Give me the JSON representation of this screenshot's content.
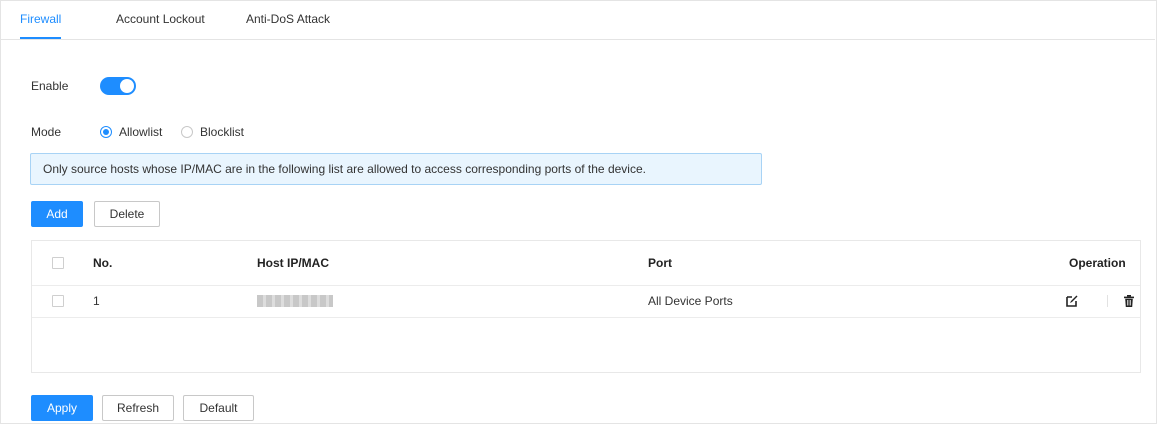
{
  "tabs": [
    {
      "label": "Firewall",
      "active": true
    },
    {
      "label": "Account Lockout",
      "active": false
    },
    {
      "label": "Anti-DoS Attack",
      "active": false
    }
  ],
  "enable": {
    "label": "Enable",
    "on": true
  },
  "mode": {
    "label": "Mode",
    "options": [
      {
        "label": "Allowlist",
        "selected": true
      },
      {
        "label": "Blocklist",
        "selected": false
      }
    ]
  },
  "info_message": "Only source hosts whose IP/MAC are in the following list are allowed to access corresponding ports of the device.",
  "toolbar": {
    "add_label": "Add",
    "delete_label": "Delete"
  },
  "table": {
    "columns": [
      "No.",
      "Host IP/MAC",
      "Port",
      "Operation"
    ],
    "rows": [
      {
        "no": "1",
        "host": "",
        "port": "All Device Ports"
      }
    ]
  },
  "footer": {
    "apply_label": "Apply",
    "refresh_label": "Refresh",
    "default_label": "Default"
  },
  "icons": {
    "edit": "edit-icon",
    "delete": "trash-icon"
  },
  "colors": {
    "accent": "#1e8dff",
    "info_bg": "#e9f5fe",
    "info_border": "#a8d3f5"
  }
}
